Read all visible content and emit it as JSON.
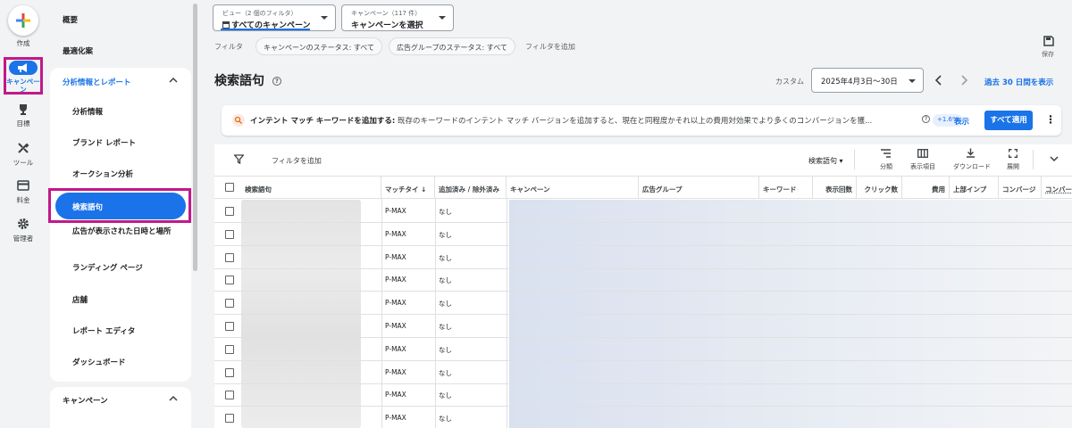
{
  "rail": {
    "create": "作成",
    "campaigns": "キャンペーン",
    "goals": "目標",
    "tools": "ツール",
    "billing": "料金",
    "admin": "管理者"
  },
  "nav": {
    "overview": "概要",
    "recommendations": "最適化案",
    "insights_section": "分析情報とレポート",
    "items": [
      "分析情報",
      "ブランド レポート",
      "オークション分析",
      "検索語句",
      "広告が表示された日時と場所",
      "ランディング ページ",
      "店舗",
      "レポート エディタ",
      "ダッシュボード"
    ],
    "campaigns_section": "キャンペーン"
  },
  "header": {
    "view_label": "ビュー（2 個のフィルタ）",
    "view_value": "すべてのキャンペーン",
    "campaign_label": "キャンペーン（117 件）",
    "campaign_value": "キャンペーンを選択",
    "filter_label": "フィルタ",
    "chip1": "キャンペーンのステータス: すべて",
    "chip2": "広告グループのステータス: すべて",
    "add_filter": "フィルタを追加",
    "save": "保存"
  },
  "page": {
    "title": "検索語句",
    "custom": "カスタム",
    "date_range": "2025年4月3日〜30日",
    "last30": "過去 30 日間を表示"
  },
  "banner": {
    "bold": "インテント マッチ キーワードを追加する:",
    "text": " 既存のキーワードのインテント マッチ バージョンを追加すると、現在と同程度かそれ以上の費用対効果でより多くのコンバージョンを獲...",
    "uplift": "+1.6%",
    "view": "表示",
    "apply_all": "すべて適用"
  },
  "toolbar": {
    "add_filter": "フィルタを追加",
    "term_dropdown": "検索語句",
    "segment": "分類",
    "columns": "表示項目",
    "download": "ダウンロード",
    "expand": "展開"
  },
  "table": {
    "headers": [
      "検索語句",
      "マッチタイ",
      "追加済み / 除外済み",
      "キャンペーン",
      "広告グループ",
      "キーワード",
      "表示回数",
      "クリック数",
      "費用",
      "上部インプ",
      "コンバージ",
      "コンバー"
    ],
    "rows": [
      {
        "match": "P-MAX",
        "added": "なし"
      },
      {
        "match": "P-MAX",
        "added": "なし"
      },
      {
        "match": "P-MAX",
        "added": "なし"
      },
      {
        "match": "P-MAX",
        "added": "なし"
      },
      {
        "match": "P-MAX",
        "added": "なし"
      },
      {
        "match": "P-MAX",
        "added": "なし"
      },
      {
        "match": "P-MAX",
        "added": "なし"
      },
      {
        "match": "P-MAX",
        "added": "なし"
      },
      {
        "match": "P-MAX",
        "added": "なし"
      },
      {
        "match": "P-MAX",
        "added": "なし"
      }
    ]
  },
  "colors": {
    "accent": "#1a73e8",
    "highlight": "#c2188b"
  }
}
